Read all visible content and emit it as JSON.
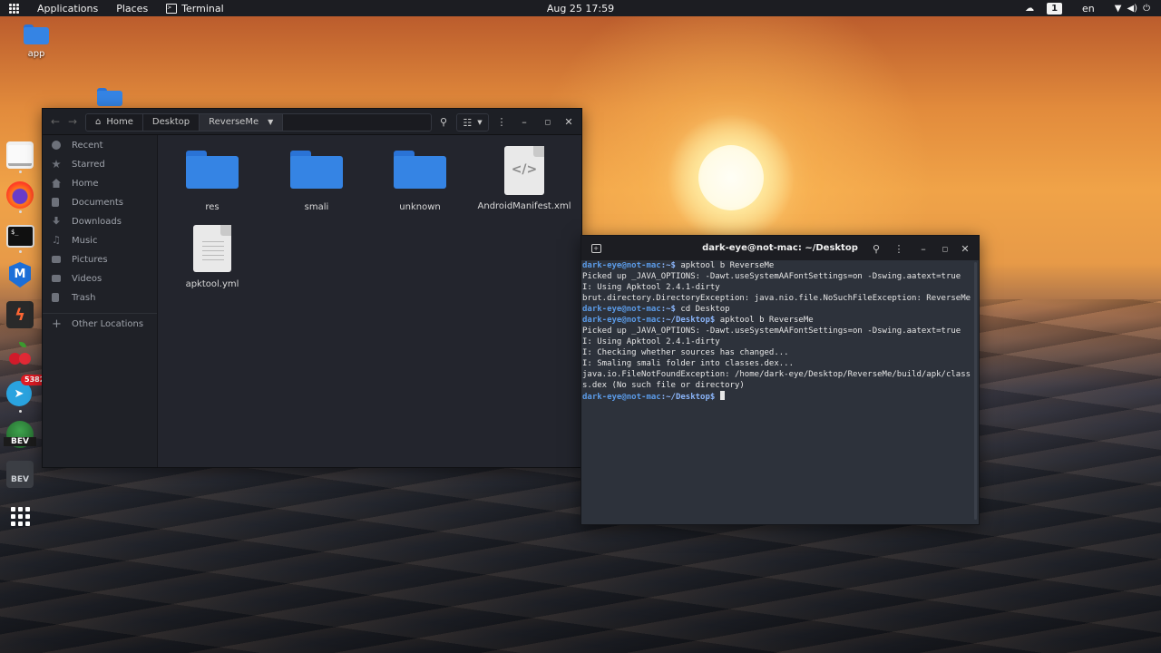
{
  "topbar": {
    "activities_icon": "grid-icon",
    "applications": "Applications",
    "places": "Places",
    "terminal_app": "Terminal",
    "clock": "Aug 25  17:59",
    "workspace": "1",
    "language": "en"
  },
  "desktop": {
    "icons": [
      {
        "label": "app"
      }
    ]
  },
  "dock": {
    "telegram_badge": "5382"
  },
  "file_manager": {
    "breadcrumbs": [
      "Home",
      "Desktop",
      "ReverseMe"
    ],
    "sidebar": [
      "Recent",
      "Starred",
      "Home",
      "Documents",
      "Downloads",
      "Music",
      "Pictures",
      "Videos",
      "Trash",
      "Other Locations"
    ],
    "items": [
      "res",
      "smali",
      "unknown",
      "AndroidManifest.xml",
      "apktool.yml"
    ]
  },
  "terminal": {
    "title": "dark-eye@not-mac: ~/Desktop",
    "user": "dark-eye@not-mac",
    "lines": {
      "l1_path": ":~$",
      "l1_cmd": " apktool b ReverseMe",
      "l2": "Picked up _JAVA_OPTIONS: -Dawt.useSystemAAFontSettings=on -Dswing.aatext=true",
      "l3": "I: Using Apktool 2.4.1-dirty",
      "l4": "brut.directory.DirectoryException: java.nio.file.NoSuchFileException: ReverseMe",
      "l5_path": ":~$",
      "l5_cmd": " cd Desktop",
      "l6_path": ":~/Desktop",
      "l6_cmd": " apktool b ReverseMe",
      "l7": "Picked up _JAVA_OPTIONS: -Dawt.useSystemAAFontSettings=on -Dswing.aatext=true",
      "l8": "I: Using Apktool 2.4.1-dirty",
      "l9": "I: Checking whether sources has changed...",
      "l10": "I: Smaling smali folder into classes.dex...",
      "l11": "java.io.FileNotFoundException: /home/dark-eye/Desktop/ReverseMe/build/apk/classe",
      "l12": "s.dex (No such file or directory)",
      "l13_path": ":~/Desktop"
    }
  },
  "colors": {
    "accent_blue": "#3584e4",
    "prompt_user": "#5b9be8",
    "badge_red": "#e01b24"
  }
}
